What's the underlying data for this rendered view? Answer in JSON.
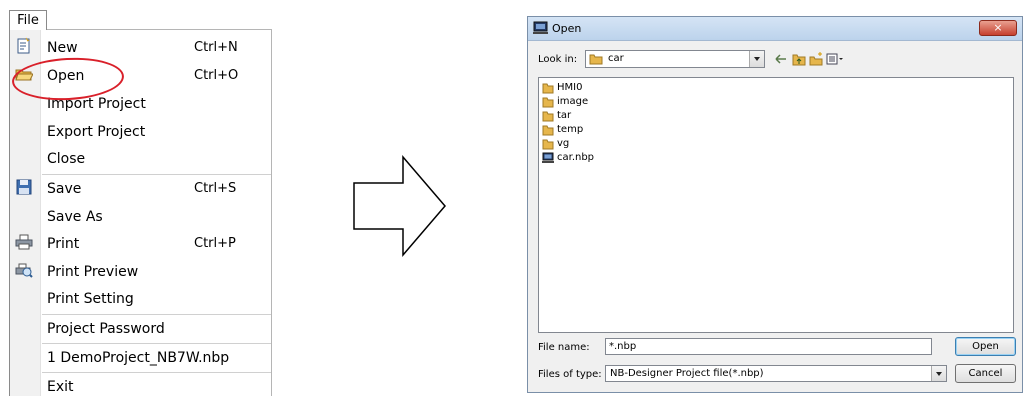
{
  "menu": {
    "title": "File",
    "items": [
      {
        "label": "New",
        "shortcut": "Ctrl+N",
        "icon": "new-document-icon"
      },
      {
        "label": "Open",
        "shortcut": "Ctrl+O",
        "icon": "open-folder-icon"
      },
      {
        "label": "Import Project",
        "shortcut": ""
      },
      {
        "label": "Export Project",
        "shortcut": ""
      },
      {
        "label": "Close",
        "shortcut": ""
      },
      {
        "label": "Save",
        "shortcut": "Ctrl+S",
        "icon": "floppy-disk-icon"
      },
      {
        "label": "Save As",
        "shortcut": ""
      },
      {
        "label": "Print",
        "shortcut": "Ctrl+P",
        "icon": "printer-icon"
      },
      {
        "label": "Print Preview",
        "shortcut": "",
        "icon": "print-preview-icon"
      },
      {
        "label": "Print Setting",
        "shortcut": ""
      },
      {
        "label": "Project Password",
        "shortcut": ""
      },
      {
        "label": "1 DemoProject_NB7W.nbp",
        "shortcut": ""
      },
      {
        "label": "Exit",
        "shortcut": ""
      }
    ],
    "highlight_color": "#d9202a"
  },
  "dialog": {
    "title": "Open",
    "close_label": "×",
    "look_in_label": "Look in:",
    "look_in_value": "car",
    "files": [
      {
        "name": "HMI0",
        "type": "folder"
      },
      {
        "name": "image",
        "type": "folder"
      },
      {
        "name": "tar",
        "type": "folder"
      },
      {
        "name": "temp",
        "type": "folder"
      },
      {
        "name": "vg",
        "type": "folder"
      },
      {
        "name": "car.nbp",
        "type": "project-file"
      }
    ],
    "file_name_label": "File name:",
    "file_name_value": "*.nbp",
    "file_type_label": "Files of type:",
    "file_type_value": "NB-Designer Project file(*.nbp)",
    "open_button": "Open",
    "cancel_button": "Cancel"
  }
}
